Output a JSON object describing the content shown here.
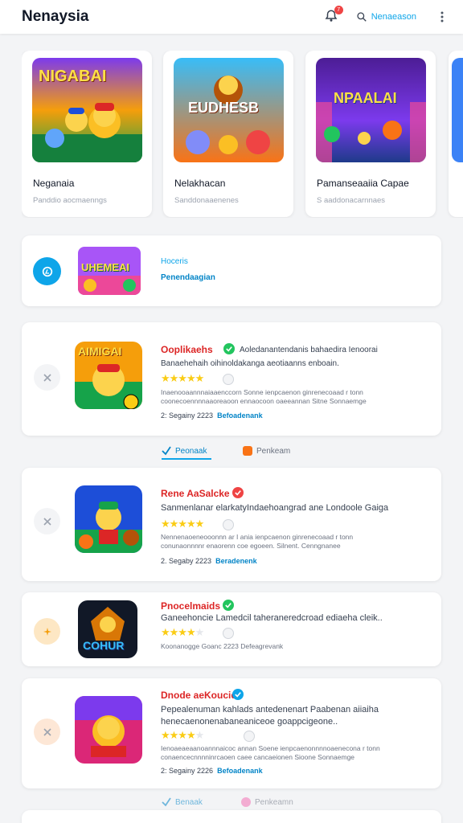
{
  "app": {
    "title": "Nenaysia",
    "notification_count": "7",
    "search_label": "Nenaeason"
  },
  "carousel": [
    {
      "title": "Neganaia",
      "subtitle": "Panddio aocmaenngs",
      "art_text": "NIGABAI"
    },
    {
      "title": "Nelakhacan",
      "subtitle": "Sanddonaaenenes",
      "art_text": "EUDHESB"
    },
    {
      "title": "Pamanseaaiia Capae",
      "subtitle": "S aaddonacarnnaes",
      "art_text": "NPAALAI"
    }
  ],
  "featured": {
    "line1": "Hoceris",
    "line2": "Penendaagian",
    "art_text": "UHEMEAI"
  },
  "apps": [
    {
      "title": "Ooplikaehs",
      "desc1": "Aoledanantendanis bahaedira Ienoorai",
      "desc2": "Banaehehaih oihinoldakanga aeotiaanns enboain.",
      "stars": 5,
      "fine1": "Inaenooaannnaiaaenccorn Sonne ienpcaenon ginrenecoaad r tonn",
      "fine2": "coonecoennnnaaoreaoon ennaocoon oaeeannan Sitne Sonnaemge",
      "date": "2: Segainy 2223",
      "dev": "Befoadenank",
      "art_text": "AIMIGAI"
    },
    {
      "title": "Rene AaSalcke",
      "desc1": "Sanmenlanar elarkatyIndaehoangrad ane Londoole Gaiga",
      "desc2": "",
      "stars": 5,
      "fine1": "Nennenaoeneooonnn ar I ania ienpcaenon ginrenecoaad r tonn",
      "fine2": "conunaonnnnr enaorenn coe egoeen. Silnent. Cenngnanee",
      "date": "2. Segaby 2223",
      "dev": "Beradenenk",
      "art_text": ""
    },
    {
      "title": "Pnocelmaids",
      "desc1": "Ganeehoncie Lamedcil taheraneredcroad ediaeha cleik..",
      "desc2": "",
      "stars": 4,
      "fine1": "Koonanogge Goanc 2223 Defeagrevank",
      "fine2": "",
      "date": "",
      "dev": "",
      "art_text": "COHUR"
    },
    {
      "title": "Dnode aeKoucide",
      "desc1": "Pepealenuman kahlads antedenenart Paabenan aiiaiha",
      "desc2": "henecaenonenabaneaniceoe goappcigeone..",
      "stars": 4,
      "fine1": "Ienoaeaeaanoannnaicoc annan Soene ienpcaenonnnnoaenecona r tonn",
      "fine2": "conaencecnnnninrcaoen caee cancaeionen Sioone Sonnaemge",
      "date": "2: Segainy 2226",
      "dev": "Befoadenank",
      "art_text": ""
    }
  ],
  "tabs_1": {
    "active": "Peonaak",
    "inactive": "Penkeam"
  },
  "tabs_2": {
    "active": "Benaak",
    "inactive": "Penkeamn"
  }
}
